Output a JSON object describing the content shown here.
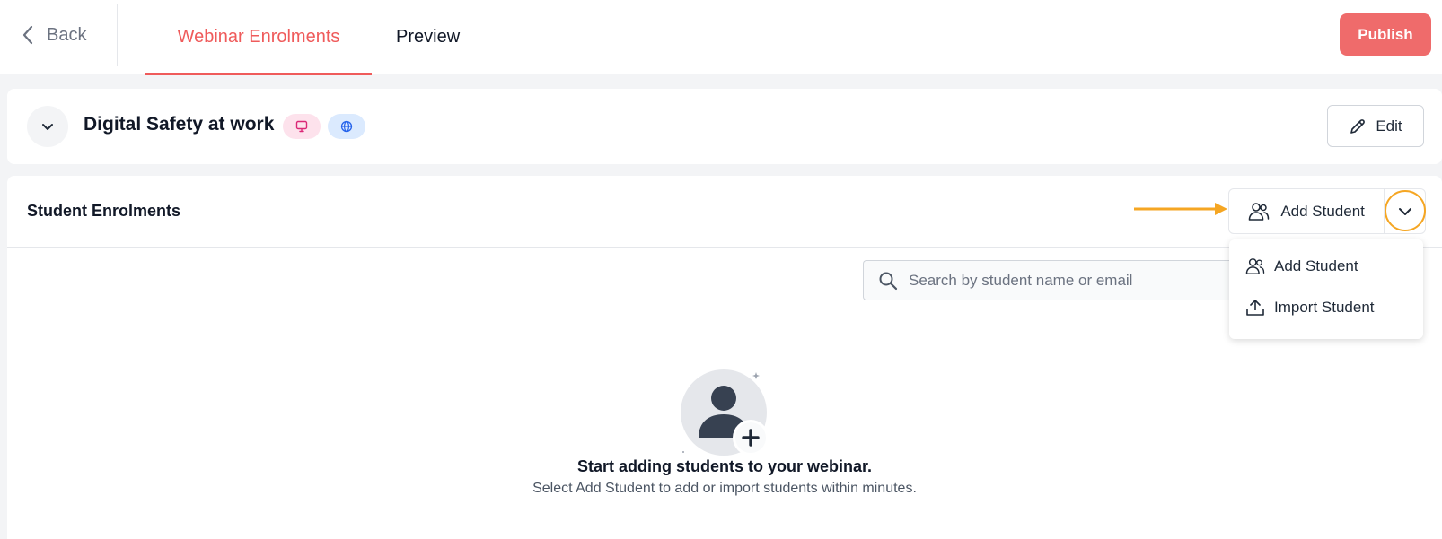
{
  "header": {
    "back_label": "Back",
    "tabs": [
      {
        "label": "Webinar Enrolments",
        "active": true
      },
      {
        "label": "Preview",
        "active": false
      }
    ],
    "publish_label": "Publish"
  },
  "course": {
    "title": "Digital Safety at work",
    "badges": [
      {
        "icon": "monitor-icon",
        "color": "#fde2ec"
      },
      {
        "icon": "globe-icon",
        "color": "#dbeafe"
      }
    ],
    "edit_label": "Edit"
  },
  "enrolments": {
    "title": "Student Enrolments",
    "add_student_label": "Add Student",
    "search": {
      "placeholder": "Search by student name or email",
      "value": ""
    },
    "menu": {
      "items": [
        {
          "label": "Add Student",
          "icon": "users-icon"
        },
        {
          "label": "Import Student",
          "icon": "upload-icon"
        }
      ]
    },
    "empty_state": {
      "title": "Start adding students to your webinar.",
      "subtitle": "Select Add Student to add or import students within minutes."
    }
  },
  "colors": {
    "accent": "#ef5b5b",
    "publish_bg": "#ef6b6b",
    "annotation": "#f5a623"
  }
}
